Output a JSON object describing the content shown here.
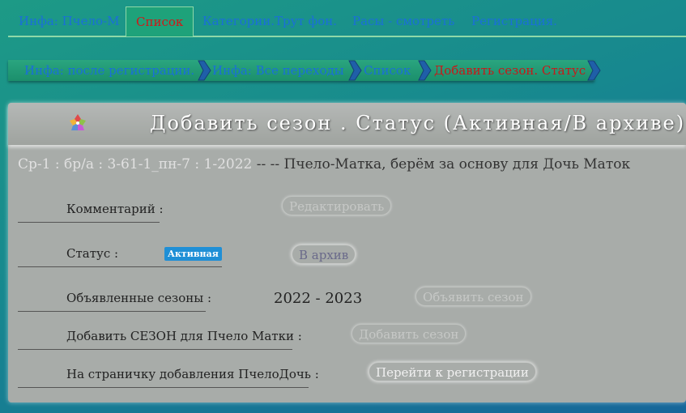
{
  "tabs": [
    {
      "label": "Инфа: Пчело-М",
      "active": false
    },
    {
      "label": "Список",
      "active": true
    },
    {
      "label": "Категории.Трут фон.",
      "active": false
    },
    {
      "label": "Расы - смотреть",
      "active": false
    },
    {
      "label": "Регистрация.",
      "active": false
    }
  ],
  "breadcrumb": [
    {
      "label": "Инфа: после регистрации."
    },
    {
      "label": "Инфа: Все переходы"
    },
    {
      "label": "Список"
    },
    {
      "label": "Добавить сезон. Статус",
      "current": true
    }
  ],
  "panel": {
    "title": "Добавить сезон . Статус (Активная/В архиве)",
    "record_code": "Ср-1 : бр/а : 3-61-1_пн-7 : 1-2022",
    "record_desc": " -- -- Пчело-Матка, берём за основу для Дочь Маток",
    "rows": {
      "comment": {
        "label": "Комментарий :",
        "button": "Редактировать"
      },
      "status": {
        "label": "Статус :",
        "badge": "Активная",
        "button": "В архив"
      },
      "seasons": {
        "label": "Объявленные сезоны :",
        "value": "2022 - 2023",
        "button": "Объявить сезон"
      },
      "add_season": {
        "label": "Добавить СЕЗОН для Пчело Матки :",
        "button": "Добавить сезон"
      },
      "registration": {
        "label": "На страничку добавления ПчелоДочь :",
        "button": "Перейти к регистрации"
      }
    }
  },
  "colors": {
    "link": "#1a6fd8",
    "active_link": "#d01818",
    "badge": "#1f8fd6"
  }
}
